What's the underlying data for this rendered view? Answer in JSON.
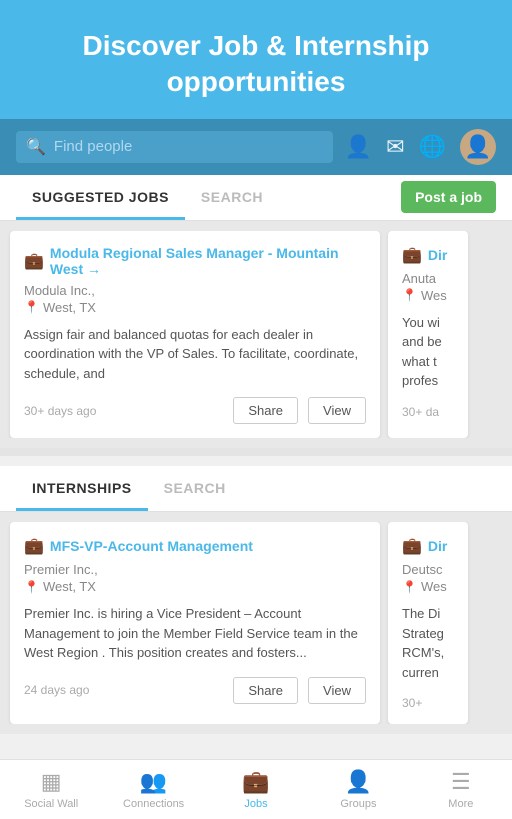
{
  "header": {
    "title": "Discover Job & Internship opportunities"
  },
  "searchBar": {
    "placeholder": "Find people",
    "icons": [
      "people-icon",
      "mail-icon",
      "globe-icon",
      "avatar-icon"
    ]
  },
  "jobsTabs": {
    "tab1": "SUGGESTED JOBS",
    "tab2": "SEARCH",
    "postJobLabel": "Post a job"
  },
  "jobs": [
    {
      "id": 1,
      "title": "Modula Regional Sales Manager - Mountain West →",
      "company": "Modula Inc.,",
      "location": "West, TX",
      "description": "Assign fair and balanced quotas for each dealer in coordination with the VP of Sales. To facilitate, coordinate, schedule, and",
      "timeAgo": "30+ days ago",
      "shareLabel": "Share",
      "viewLabel": "View"
    },
    {
      "id": 2,
      "title": "Dir",
      "company": "Anuta",
      "location": "Wes",
      "description": "You wi and be what t profes",
      "timeAgo": "30+ da"
    }
  ],
  "internshipsTabs": {
    "tab1": "INTERNSHIPS",
    "tab2": "SEARCH"
  },
  "internships": [
    {
      "id": 1,
      "title": "MFS-VP-Account Management",
      "company": "Premier Inc.,",
      "location": "West, TX",
      "description": "Premier Inc. is hiring a Vice President – Account Management to join the Member Field Service team in the West Region . This position creates and fosters...",
      "timeAgo": "24 days ago",
      "shareLabel": "Share",
      "viewLabel": "View"
    },
    {
      "id": 2,
      "title": "Dir",
      "company": "Deutsc",
      "location": "Wes",
      "description": "The Di Strateg RCM's, curren",
      "timeAgo": "30+"
    }
  ],
  "bottomNav": {
    "items": [
      {
        "label": "Social Wall",
        "icon": "grid-icon",
        "active": false
      },
      {
        "label": "Connections",
        "icon": "connections-icon",
        "active": false
      },
      {
        "label": "Jobs",
        "icon": "jobs-icon",
        "active": true
      },
      {
        "label": "Groups",
        "icon": "groups-icon",
        "active": false
      },
      {
        "label": "More",
        "icon": "more-icon",
        "active": false
      }
    ]
  },
  "colors": {
    "accent": "#4ab8e8",
    "green": "#5cb85c",
    "briefcase": "#8B6914"
  }
}
